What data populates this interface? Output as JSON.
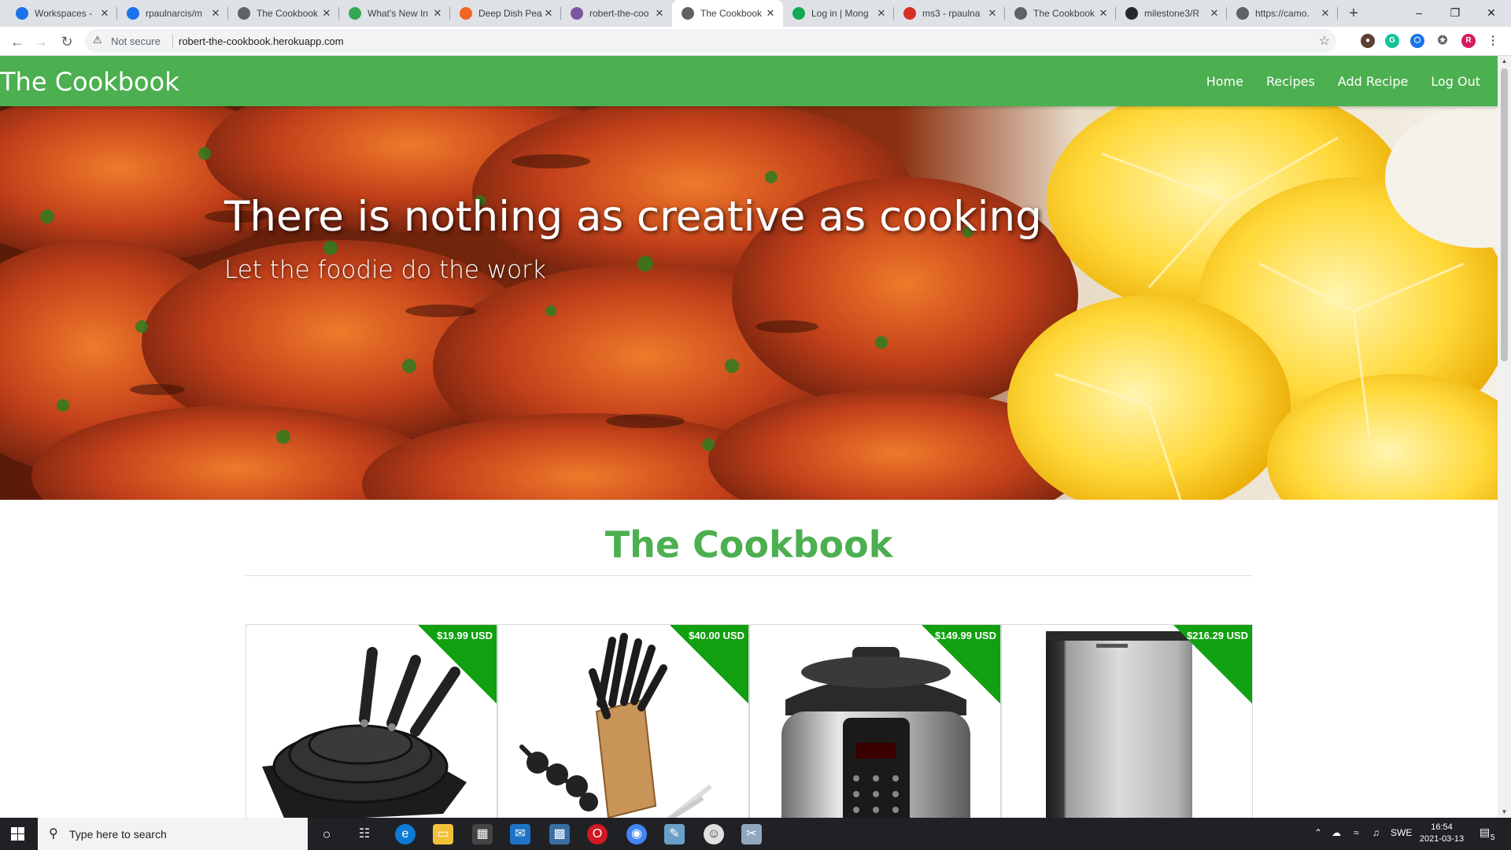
{
  "browser": {
    "tabs": [
      {
        "title": "Workspaces - ",
        "favicon": "workspaces-icon",
        "color": "#1a73e8",
        "left": 0
      },
      {
        "title": "rpaulnarcis/m",
        "favicon": "workspaces-icon",
        "color": "#1a73e8",
        "left": 0
      },
      {
        "title": "The Cookbook",
        "favicon": "globe-icon",
        "color": "#5f6368",
        "left": 0
      },
      {
        "title": "What's New In",
        "favicon": "code-icon",
        "color": "#34a853",
        "left": 0
      },
      {
        "title": "Deep Dish Pea",
        "favicon": "dp-icon",
        "color": "#f26522",
        "left": 0
      },
      {
        "title": "robert-the-coo",
        "favicon": "heroku-icon",
        "color": "#79589f",
        "left": 0
      },
      {
        "title": "The Cookbook",
        "favicon": "globe-icon",
        "color": "#5f6368",
        "left": 0
      },
      {
        "title": "Log in | Mong",
        "favicon": "leaf-icon",
        "color": "#13aa52",
        "left": 0
      },
      {
        "title": "ms3 - rpaulna",
        "favicon": "gmail-icon",
        "color": "#d93025",
        "left": 0
      },
      {
        "title": "The Cookbook",
        "favicon": "globe-icon",
        "color": "#5f6368",
        "left": 0
      },
      {
        "title": "milestone3/R",
        "favicon": "github-icon",
        "color": "#24292e",
        "left": 0
      },
      {
        "title": "https://camo.",
        "favicon": "globe-icon",
        "color": "#5f6368",
        "left": 0
      }
    ],
    "active_tab_index": 6,
    "security_label": "Not secure",
    "url": "robert-the-cookbook.herokuapp.com"
  },
  "site": {
    "brand": "The Cookbook",
    "nav": [
      "Home",
      "Recipes",
      "Add Recipe",
      "Log Out"
    ],
    "hero_title": "There is nothing as creative as cooking",
    "hero_subtitle": "Let the foodie do the work",
    "section_title": "The Cookbook",
    "products": [
      {
        "price": "$19.99 USD",
        "image": "frying-pan-set"
      },
      {
        "price": "$40.00 USD",
        "image": "knife-block-set"
      },
      {
        "price": "$149.99 USD",
        "image": "pressure-cooker"
      },
      {
        "price": "$216.29 USD",
        "image": "mini-fridge"
      }
    ],
    "accent_color": "#4caf50",
    "ribbon_color": "#10a010"
  },
  "taskbar": {
    "search_placeholder": "Type here to search",
    "language": "SWE",
    "time": "16:54",
    "date": "2021-03-13",
    "notification_count": "5"
  }
}
